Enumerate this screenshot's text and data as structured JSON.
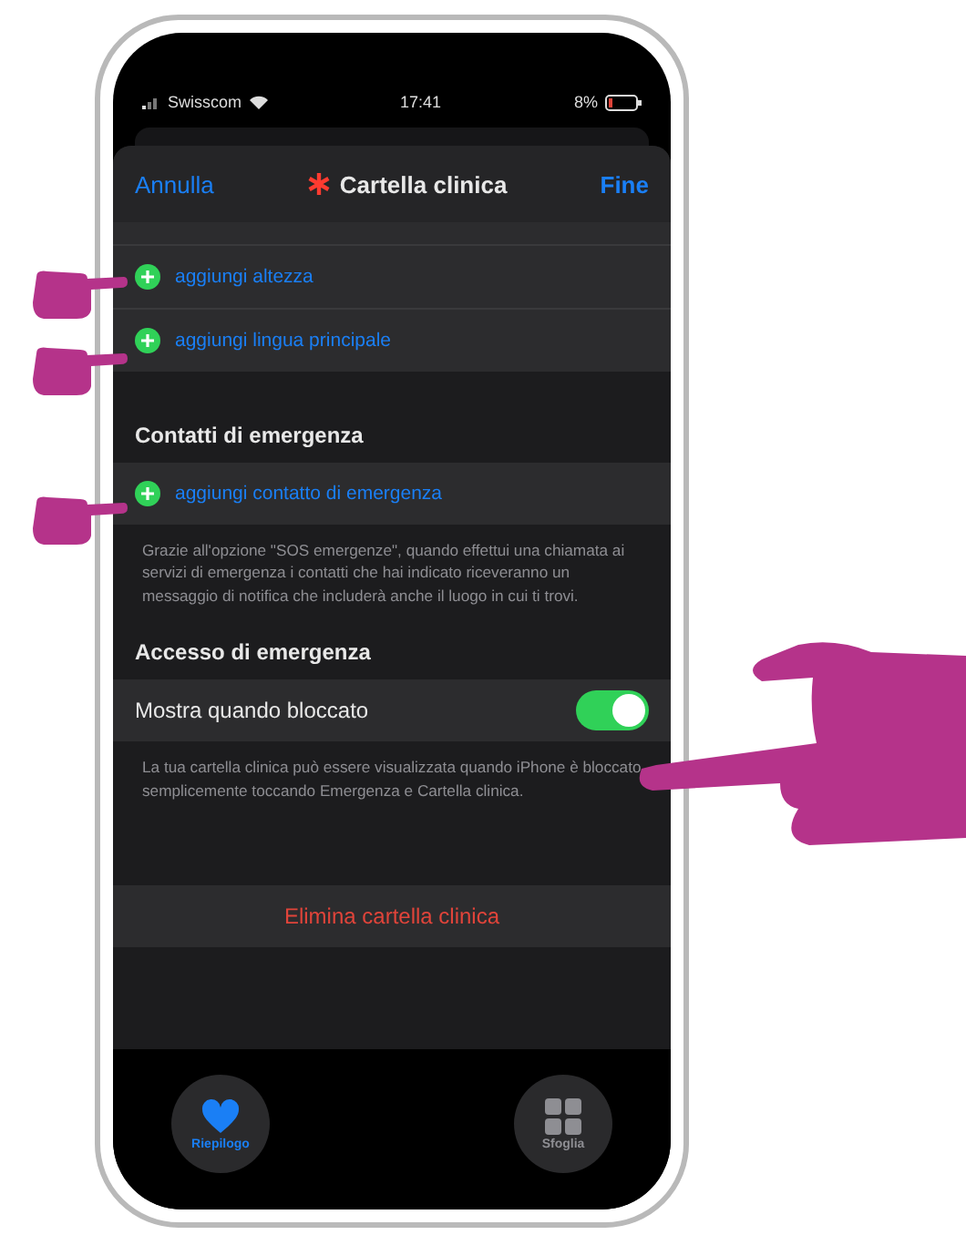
{
  "status_bar": {
    "carrier": "Swisscom",
    "time": "17:41",
    "battery": "8%"
  },
  "sheet": {
    "cancel": "Annulla",
    "title": "Cartella clinica",
    "done": "Fine"
  },
  "details": [
    {
      "label": "aggiungi altezza"
    },
    {
      "label": "aggiungi lingua principale"
    }
  ],
  "sections": [
    {
      "title": "Contatti di emergenza",
      "rows": [
        {
          "kind": "add",
          "label": "aggiungi contatto di emergenza"
        }
      ],
      "footer": "Grazie all'opzione \"SOS emergenze\", quando effettui una chiamata ai servizi di emergenza i contatti che hai indicato riceveranno un messaggio di notifica che includerà anche il luogo in cui ti trovi."
    },
    {
      "title": "Accesso di emergenza",
      "rows": [
        {
          "kind": "toggle",
          "label": "Mostra quando bloccato",
          "on": true
        }
      ],
      "footer": "La tua cartella clinica può essere visualizzata quando iPhone è bloccato semplicemente toccando Emergenza e Cartella clinica."
    }
  ],
  "delete": "Elimina cartella clinica",
  "tab_bar": [
    {
      "kind": "heart",
      "label": "Riepilogo",
      "selected": true
    },
    {
      "kind": "grid",
      "label": "Sfoglia",
      "selected": false
    }
  ]
}
